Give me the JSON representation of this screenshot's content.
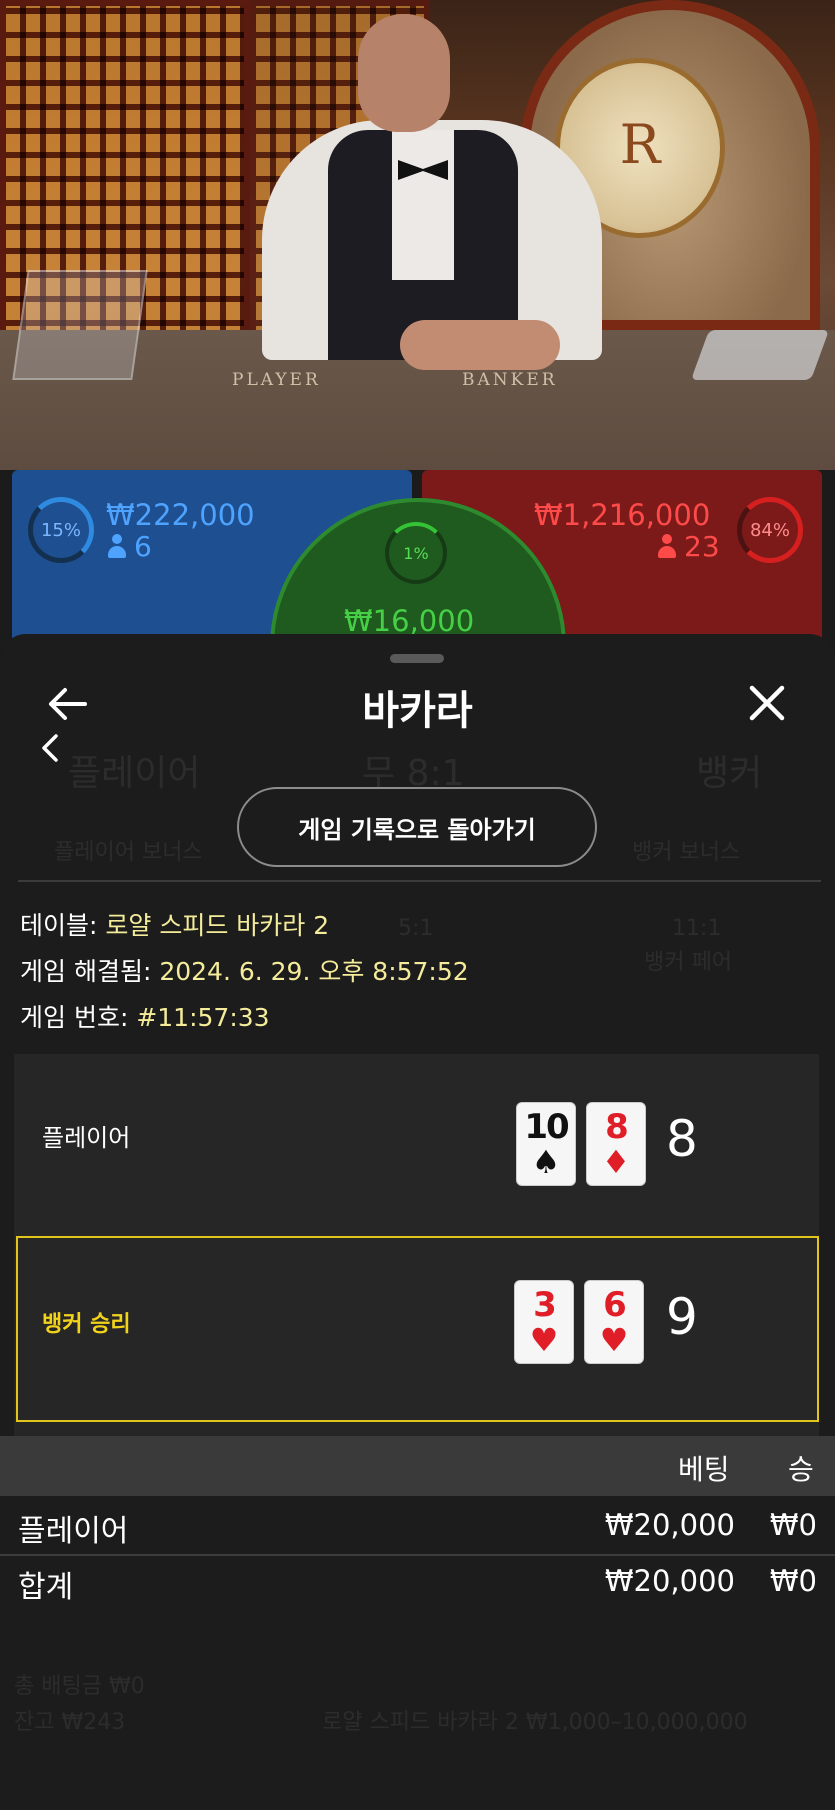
{
  "video": {
    "player_felt_label": "PLAYER",
    "banker_felt_label": "BANKER",
    "emblem_letter": "R"
  },
  "bets": {
    "player": {
      "percent": "15%",
      "amount": "₩222,000",
      "count": "6",
      "color": "#2f8be0"
    },
    "banker": {
      "percent": "84%",
      "amount": "₩1,216,000",
      "count": "23",
      "color": "#d62020"
    },
    "tie": {
      "percent": "1%",
      "amount": "₩16,000",
      "color": "#35c235"
    }
  },
  "background_board": {
    "player": "플레이어",
    "tie": "무 8:1",
    "banker": "뱅커",
    "player_bonus": "플레이어 보너스",
    "banker_bonus": "뱅커 보너스",
    "odds_5": "5:1",
    "odds_11": "11:1",
    "banker_pair": "뱅커 페어",
    "balance": "잔고 ₩243",
    "total_bet": "총 배팅금 ₩0",
    "table_limits": "로얄 스피드 바카라 2 ₩1,000–10,000,000"
  },
  "sheet": {
    "title": "바카라",
    "history_button": "게임 기록으로 돌아가기",
    "table_label": "테이블:",
    "table_value": "로얄 스피드 바카라 2",
    "resolved_label": "게임 해결됨:",
    "resolved_value": "2024. 6. 29. 오후 8:57:52",
    "game_no_label": "게임 번호:",
    "game_no_value": "#11:57:33"
  },
  "result": {
    "player": {
      "label": "플레이어",
      "cards": [
        {
          "rank": "10",
          "suit": "♠",
          "color": "black"
        },
        {
          "rank": "8",
          "suit": "♦",
          "color": "red"
        }
      ],
      "score": "8"
    },
    "banker": {
      "label": "뱅커 승리",
      "cards": [
        {
          "rank": "3",
          "suit": "♥",
          "color": "red"
        },
        {
          "rank": "6",
          "suit": "♥",
          "color": "red"
        }
      ],
      "score": "9",
      "highlight_color": "#e2c51a"
    }
  },
  "bet_table": {
    "col_bet": "베팅",
    "col_win": "승",
    "rows": [
      {
        "name": "플레이어",
        "bet": "₩20,000",
        "win": "₩0"
      },
      {
        "name": "합계",
        "bet": "₩20,000",
        "win": "₩0"
      }
    ]
  }
}
